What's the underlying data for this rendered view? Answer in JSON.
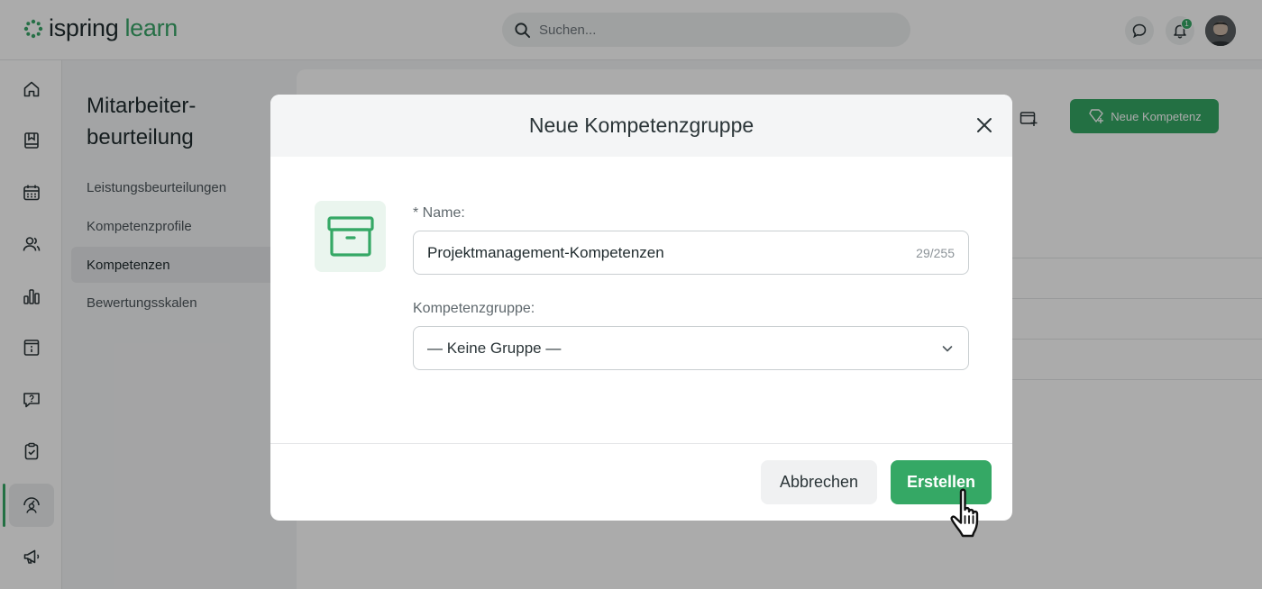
{
  "app": {
    "logo_part1": "ispring",
    "logo_part2": "learn",
    "search_placeholder": "Suchen...",
    "notification_count": "1",
    "accent_color": "#35a865"
  },
  "leftnav": {
    "items": [
      "home-icon",
      "book-icon",
      "calendar-icon",
      "users-icon",
      "bar-chart-icon",
      "info-card-icon",
      "question-chat-icon",
      "clipboard-check-icon",
      "performance-gauge-icon",
      "megaphone-icon"
    ],
    "active": "performance-gauge-icon"
  },
  "subnav": {
    "title": "Mitarbeiter-beurteilung",
    "items": [
      {
        "label": "Leistungsbeurteilungen"
      },
      {
        "label": "Kompetenzprofile"
      },
      {
        "label": "Kompetenzen"
      },
      {
        "label": "Bewertungsskalen"
      }
    ],
    "active_index": 2
  },
  "content": {
    "new_competency_label": "Neue Kompetenz"
  },
  "modal": {
    "title": "Neue Kompetenzgruppe",
    "icon": "archive-box-icon",
    "name_label": "* Name:",
    "name_value": "Projektmanagement-Kompetenzen",
    "name_counter": "29/255",
    "group_label": "Kompetenzgruppe:",
    "group_value": "— Keine Gruppe —",
    "cancel_label": "Abbrechen",
    "create_label": "Erstellen"
  }
}
